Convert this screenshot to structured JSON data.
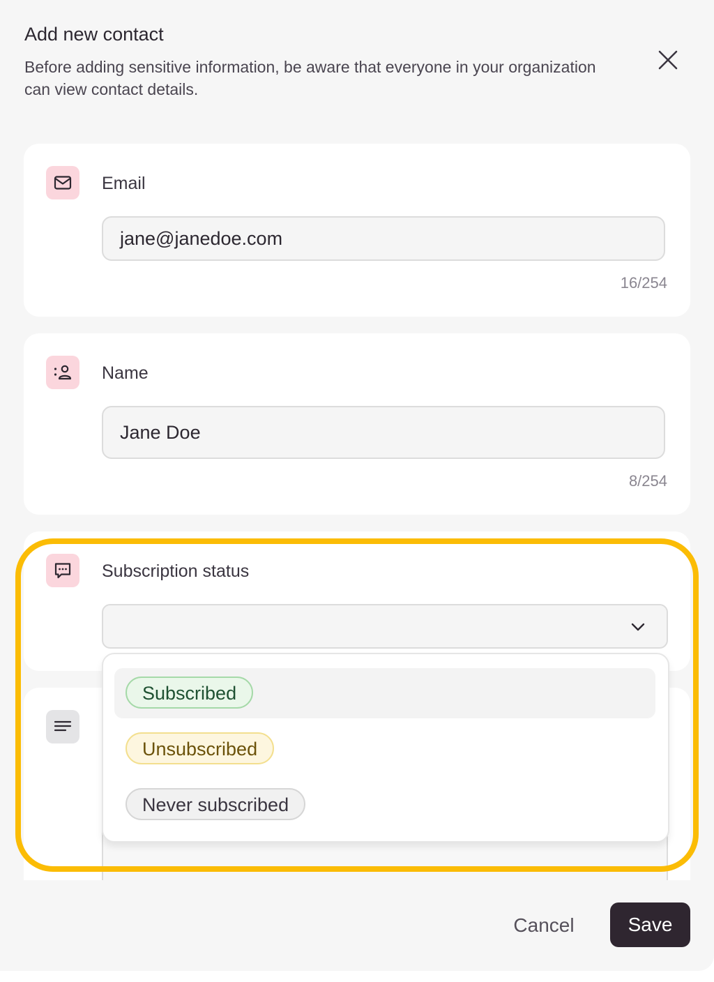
{
  "dialog": {
    "title": "Add new contact",
    "subtitle": "Before adding sensitive information, be aware that everyone in your organization can view contact details.",
    "close_icon": "close-icon"
  },
  "fields": {
    "email": {
      "label": "Email",
      "value": "jane@janedoe.com",
      "counter": "16/254",
      "icon": "mail-icon"
    },
    "name": {
      "label": "Name",
      "value": "Jane Doe",
      "counter": "8/254",
      "icon": "contact-icon"
    },
    "subscription": {
      "label": "Subscription status",
      "value": "",
      "icon": "chat-bubble-icon",
      "options": [
        {
          "label": "Subscribed",
          "style": "green"
        },
        {
          "label": "Unsubscribed",
          "style": "yellow"
        },
        {
          "label": "Never subscribed",
          "style": "gray"
        }
      ]
    },
    "notes": {
      "icon": "text-lines-icon"
    }
  },
  "footer": {
    "cancel_label": "Cancel",
    "save_label": "Save"
  },
  "colors": {
    "accent_pink_bg": "#fbd6dd",
    "save_button": "#2f2630",
    "highlight": "#fbbc05",
    "subscribed_border": "#a5d9a8",
    "unsubscribed_border": "#f3df8e"
  }
}
